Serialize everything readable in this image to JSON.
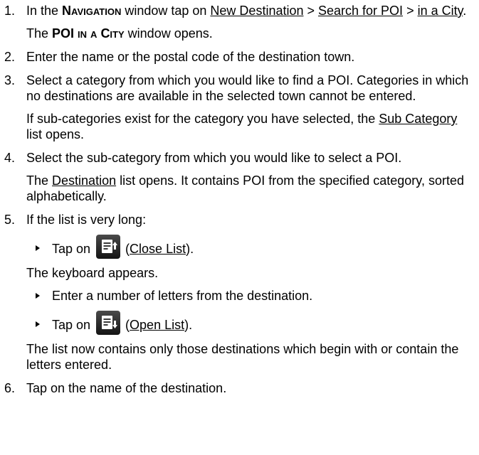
{
  "steps": [
    {
      "num": "1.",
      "a_pre": "In the ",
      "a_screen": "Navigation",
      "a_mid": " window tap on ",
      "a_link1": "New Destination",
      "a_sep1": " > ",
      "a_link2": "Search for POI",
      "a_sep2": " > ",
      "a_link3": "in a City",
      "a_end": ".",
      "b_bold1": "POI",
      "b_sc": " in a City",
      "b_rest": " window opens.",
      "b_pre": "The "
    },
    {
      "num": "2.",
      "text": "Enter the name or the postal code of the destination town."
    },
    {
      "num": "3.",
      "text": "Select a category from which you would like to find a POI. Categories in which no destinations are available in the selected town cannot be entered.",
      "b_pre": "If sub-categories exist for the category you have selected, the ",
      "b_link": "Sub Category",
      "b_post": " list opens."
    },
    {
      "num": "4.",
      "text": "Select the sub-category from which you would like to select a POI.",
      "b_pre": "The ",
      "b_link": "Destination",
      "b_post": " list opens. It contains POI from the specified category, sorted alphabetically."
    },
    {
      "num": "5.",
      "text": "If the list is very long:",
      "bullet1_pre": "Tap on ",
      "bullet1_link": "Close List",
      "bullet1_open": " (",
      "bullet1_close": ").",
      "icon1": "close-list-icon",
      "after1": "The keyboard appears.",
      "bullet2": "Enter a number of letters from the destination.",
      "bullet3_pre": "Tap on ",
      "bullet3_link": "Open List",
      "bullet3_open": " (",
      "bullet3_close": ").",
      "icon2": "open-list-icon",
      "after3": "The list now contains only those destinations which begin with or contain the letters entered."
    },
    {
      "num": "6.",
      "text": "Tap on the name of the destination."
    }
  ]
}
